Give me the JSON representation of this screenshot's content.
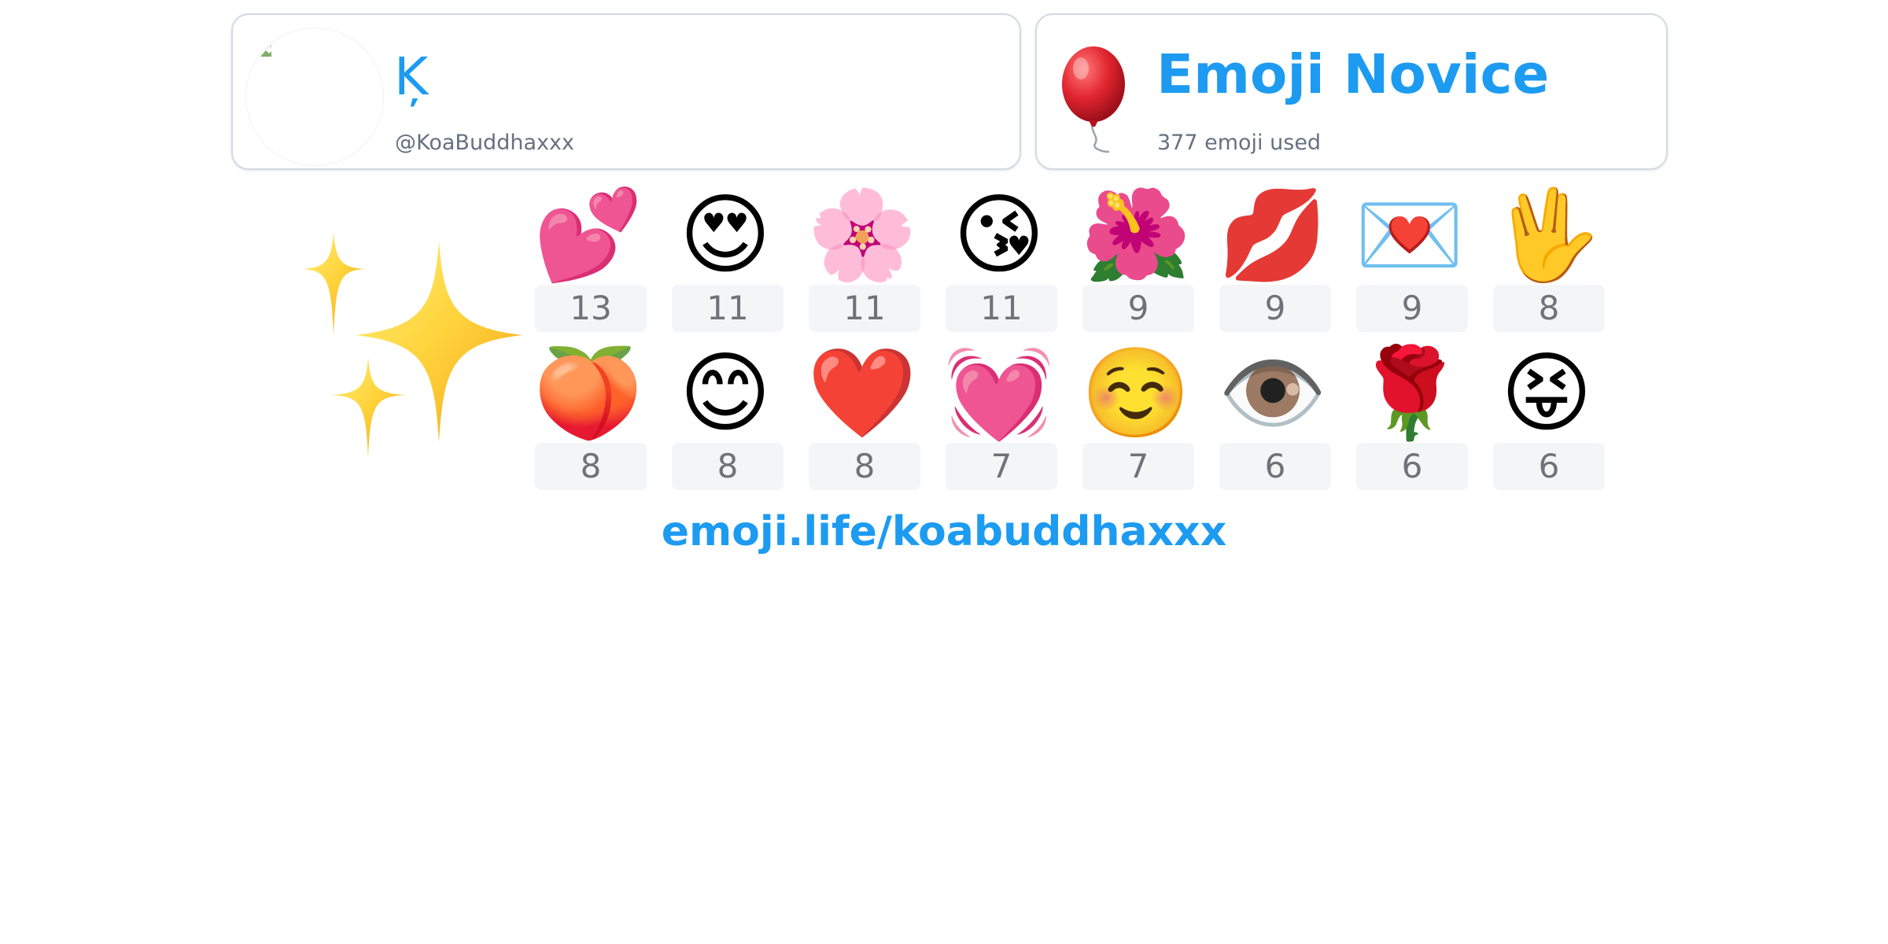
{
  "profile": {
    "display_name": "Ķ",
    "handle": "@KoaBuddhaxxx",
    "avatar_icon": "broken-image-icon"
  },
  "rank": {
    "icon": "balloon-icon",
    "title": "Emoji Novice",
    "subtitle": "377 emoji used"
  },
  "decoration": {
    "icon": "sparkles-icon"
  },
  "top_emoji": [
    {
      "emoji": "💕",
      "name": "two-hearts",
      "count": "13"
    },
    {
      "emoji": "😍",
      "name": "heart-eyes",
      "count": "11"
    },
    {
      "emoji": "🌸",
      "name": "cherry-blossom",
      "count": "11"
    },
    {
      "emoji": "😘",
      "name": "face-blowing-kiss",
      "count": "11"
    },
    {
      "emoji": "🌺",
      "name": "hibiscus",
      "count": "9"
    },
    {
      "emoji": "💋",
      "name": "kiss-mark",
      "count": "9"
    },
    {
      "emoji": "💌",
      "name": "love-letter",
      "count": "9"
    },
    {
      "emoji": "🖖",
      "name": "vulcan-salute",
      "count": "8"
    },
    {
      "emoji": "🍑",
      "name": "peach",
      "count": "8"
    },
    {
      "emoji": "😊",
      "name": "smiling-face-smiling-eyes",
      "count": "8"
    },
    {
      "emoji": "❤️",
      "name": "red-heart",
      "count": "8"
    },
    {
      "emoji": "💓",
      "name": "beating-heart",
      "count": "7"
    },
    {
      "emoji": "☺️",
      "name": "smiling-face",
      "count": "7"
    },
    {
      "emoji": "👁️",
      "name": "eye",
      "count": "6"
    },
    {
      "emoji": "🌹",
      "name": "rose",
      "count": "6"
    },
    {
      "emoji": "😝",
      "name": "squinting-tongue",
      "count": "6"
    }
  ],
  "footer": {
    "link_text": "emoji.life/koabuddhaxxx"
  },
  "colors": {
    "accent": "#1d9bf0",
    "muted_text": "#657180",
    "count_bg": "#f4f5f7",
    "count_text": "#6f7378",
    "card_border": "#d3d9e4"
  }
}
